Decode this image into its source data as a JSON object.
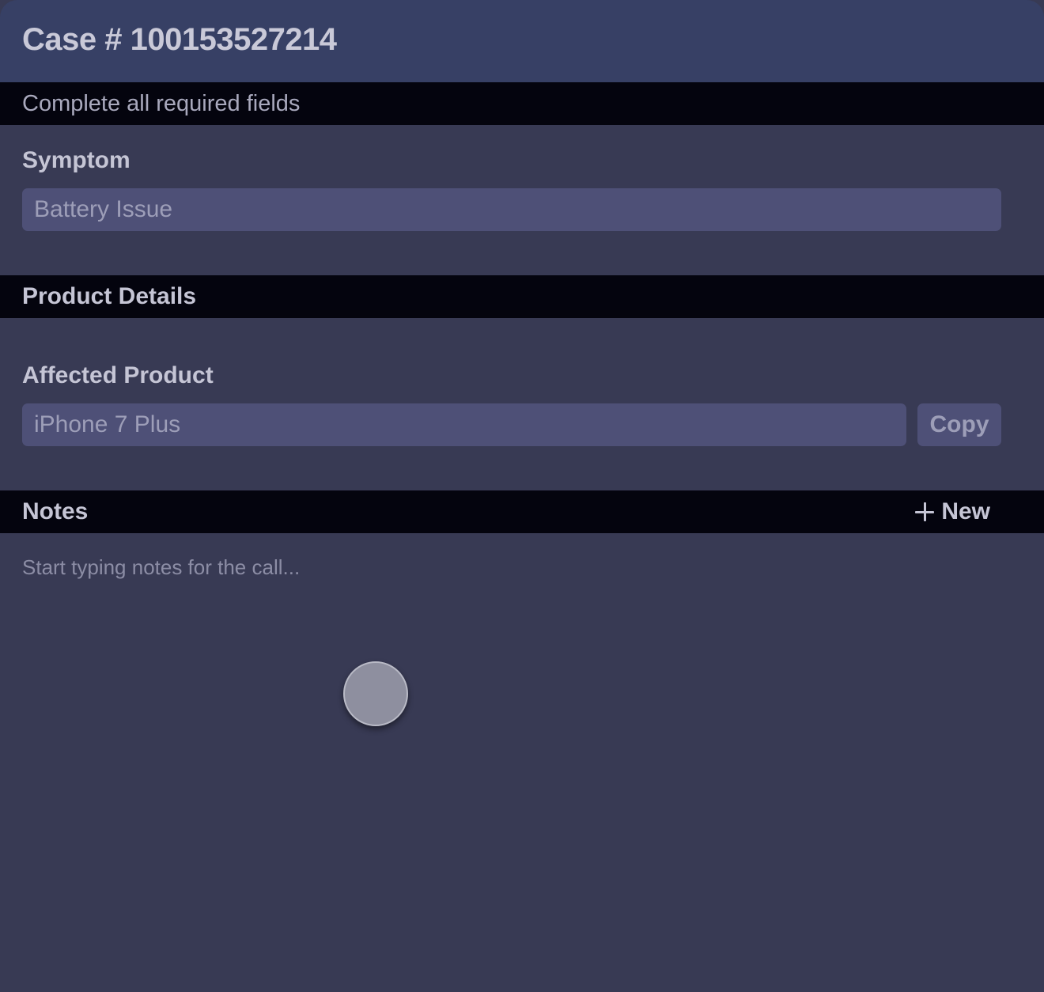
{
  "header": {
    "case_title": "Case # 100153527214"
  },
  "subbar": {
    "text": "Complete all required fields"
  },
  "symptom": {
    "label": "Symptom",
    "value": "Battery Issue"
  },
  "product_details": {
    "title": "Product Details",
    "affected_product_label": "Affected Product",
    "affected_product_value": "iPhone 7 Plus",
    "copy_label": "Copy"
  },
  "notes": {
    "title": "Notes",
    "new_label": "New",
    "placeholder": "Start typing notes for the call..."
  },
  "colors": {
    "header_bg": "#374065",
    "bar_bg": "#04040e",
    "panel_bg": "#383a54",
    "field_bg": "#4e5077"
  },
  "icons": {
    "new": "plus-icon"
  }
}
